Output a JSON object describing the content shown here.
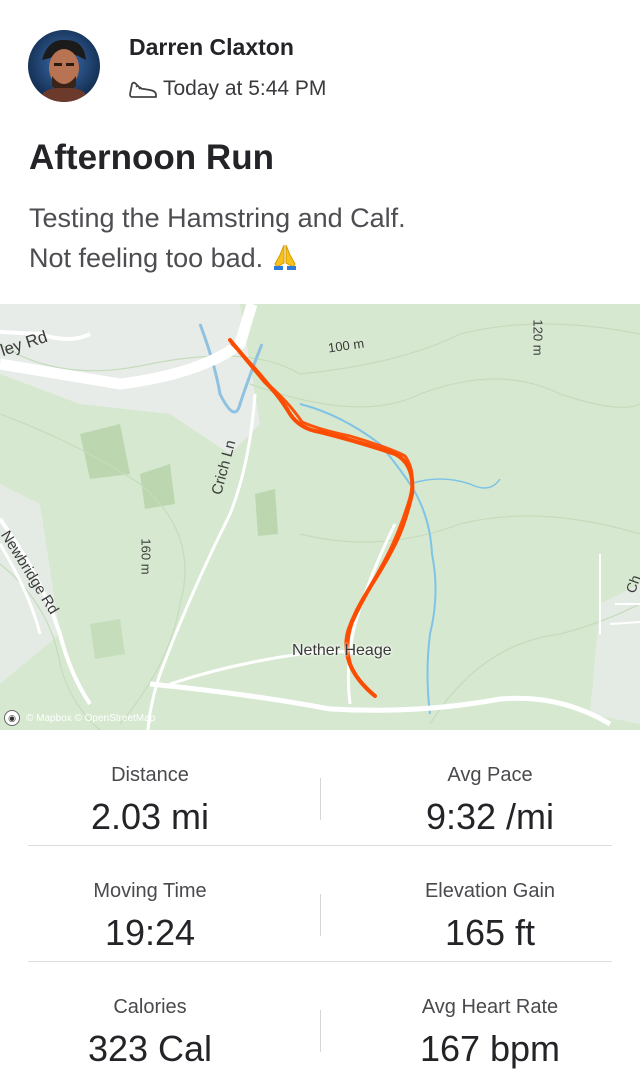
{
  "activity": {
    "author": "Darren Claxton",
    "time": "Today at 5:44 PM",
    "title": "Afternoon Run",
    "description_lines": [
      "Testing the Hamstring and Calf.",
      "Not feeling too bad."
    ],
    "emoji": "🙏"
  },
  "map": {
    "labels": {
      "road_1": "ley Rd",
      "road_2": "Crich Ln",
      "road_3": "Newbridge Rd",
      "contour_1": "100 m",
      "contour_2": "120 m",
      "contour_3": "160 m",
      "place": "Nether Heage",
      "road_4": "Ch"
    },
    "attribution": "© Mapbox © OpenStreetMap",
    "route_color": "#fc4c02"
  },
  "stats": [
    {
      "label": "Distance",
      "value": "2.03 mi"
    },
    {
      "label": "Avg Pace",
      "value": "9:32 /mi"
    },
    {
      "label": "Moving Time",
      "value": "19:24"
    },
    {
      "label": "Elevation Gain",
      "value": "165 ft"
    },
    {
      "label": "Calories",
      "value": "323 Cal"
    },
    {
      "label": "Avg Heart Rate",
      "value": "167 bpm"
    }
  ]
}
